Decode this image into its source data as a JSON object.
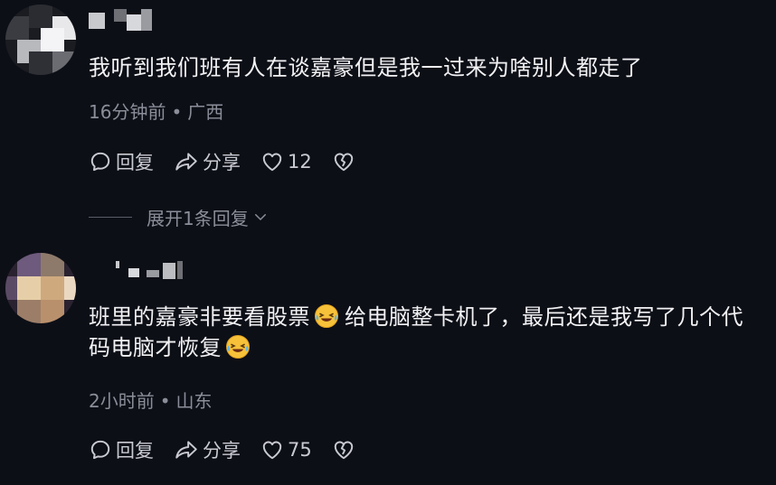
{
  "comments": [
    {
      "text": "我听到我们班有人在谈嘉豪但是我一过来为啥别人都走了",
      "time": "16分钟前",
      "location": "广西",
      "reply_label": "回复",
      "share_label": "分享",
      "likes": "12",
      "expand_label": "展开1条回复"
    },
    {
      "text_part1": "班里的嘉豪非要看股票",
      "text_part2": "给电脑整卡机了，最后还是我写了几个代码电脑才恢复",
      "time": "2小时前",
      "location": "山东",
      "reply_label": "回复",
      "share_label": "分享",
      "likes": "75"
    }
  ],
  "meta_separator": "•",
  "icons": {
    "reply": "comment-bubble-icon",
    "share": "share-arrow-icon",
    "like": "heart-icon",
    "dislike": "broken-heart-icon",
    "expand": "chevron-down-icon",
    "emoji": "laughing-crying-emoji"
  },
  "colors": {
    "background": "#0d0f17",
    "text": "#f2f2f4",
    "meta": "#8b8d98",
    "action": "#c9cad2"
  }
}
